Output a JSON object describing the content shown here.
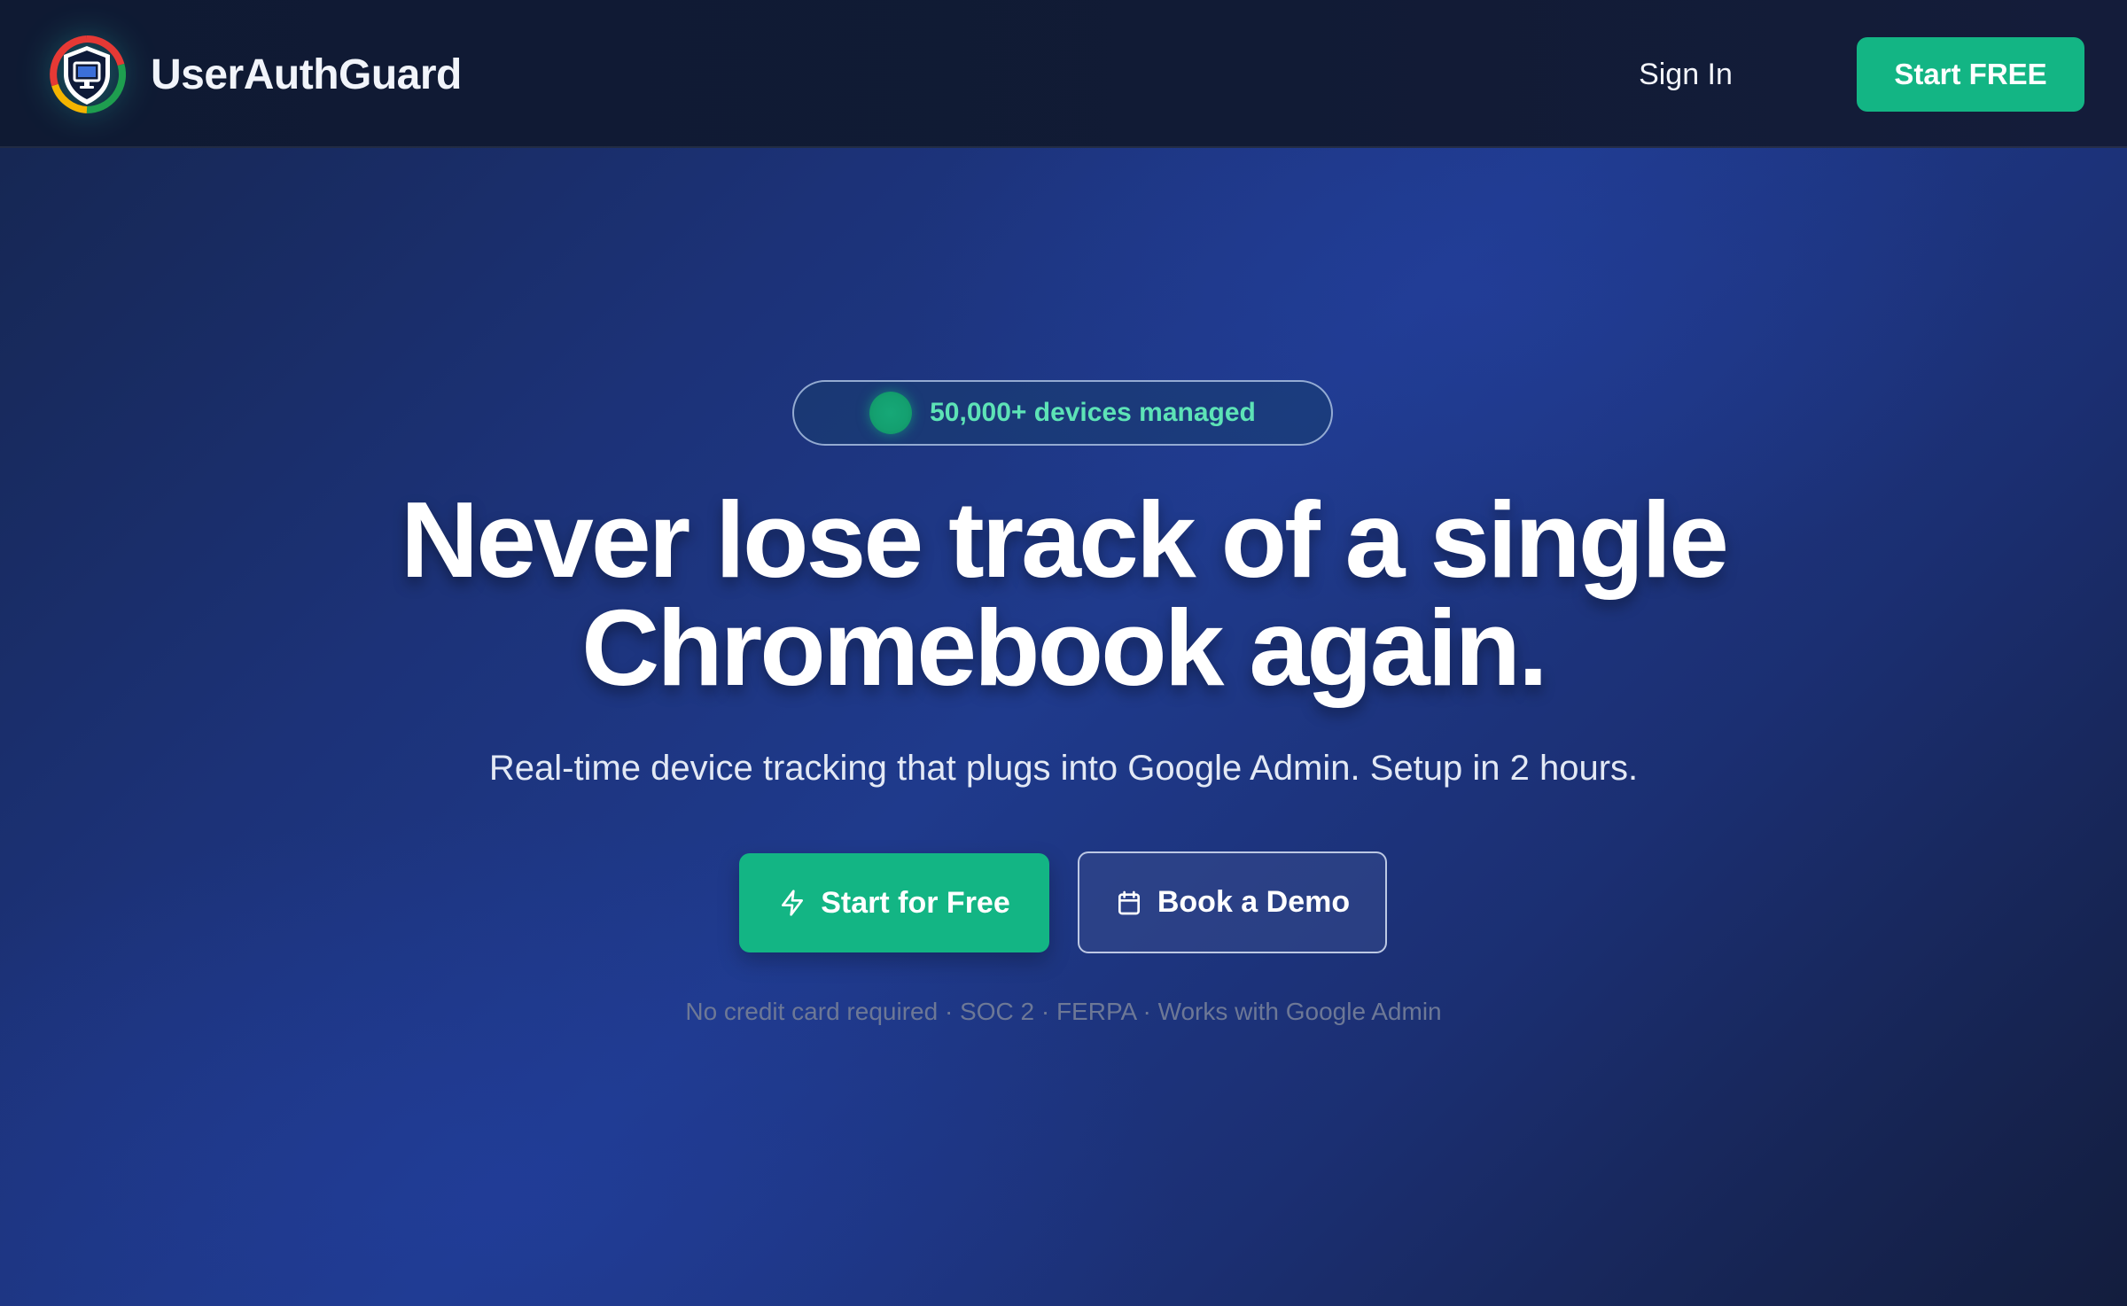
{
  "header": {
    "brand_name": "UserAuthGuard",
    "logo_icon": "shield-monitor-icon",
    "signin_label": "Sign In",
    "start_free_label": "Start FREE"
  },
  "hero": {
    "badge_text": "50,000+ devices managed",
    "headline_line1": "Never lose track of a single",
    "headline_line2": "Chromebook again.",
    "subheadline": "Real-time device tracking that plugs into Google Admin. Setup in 2 hours.",
    "primary_cta": {
      "label": "Start for Free",
      "icon": "lightning-bolt-icon"
    },
    "secondary_cta": {
      "label": "Book a Demo",
      "icon": "calendar-icon"
    },
    "trust_line": "No credit card required · SOC 2 · FERPA · Works with Google Admin"
  },
  "colors": {
    "accent_green": "#13b584",
    "badge_text_green": "#5de3b6",
    "header_bg": "#111b35",
    "hero_blue": "#1f3a8c"
  }
}
